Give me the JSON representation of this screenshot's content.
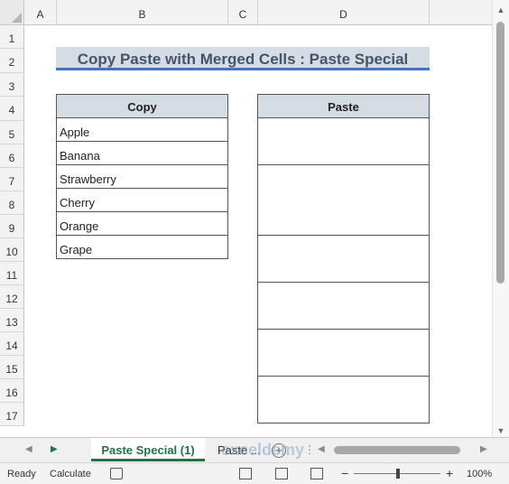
{
  "columns": [
    "A",
    "B",
    "C",
    "D"
  ],
  "rows": [
    "1",
    "2",
    "3",
    "4",
    "5",
    "6",
    "7",
    "8",
    "9",
    "10",
    "11",
    "12",
    "13",
    "14",
    "15",
    "16",
    "17"
  ],
  "title": "Copy Paste with Merged Cells : Paste Special",
  "copy_table": {
    "header": "Copy",
    "items": [
      "Apple",
      "Banana",
      "Strawberry",
      "Cherry",
      "Orange",
      "Grape"
    ]
  },
  "paste_table": {
    "header": "Paste",
    "cells": [
      "",
      "",
      "",
      "",
      "",
      ""
    ]
  },
  "sheet_tabs": {
    "active": "Paste Special (1)",
    "other": "Paste ..."
  },
  "status": {
    "ready": "Ready",
    "calculate": "Calculate",
    "zoom": "100%",
    "minus": "−",
    "plus": "+"
  },
  "watermark": "exceldemy"
}
